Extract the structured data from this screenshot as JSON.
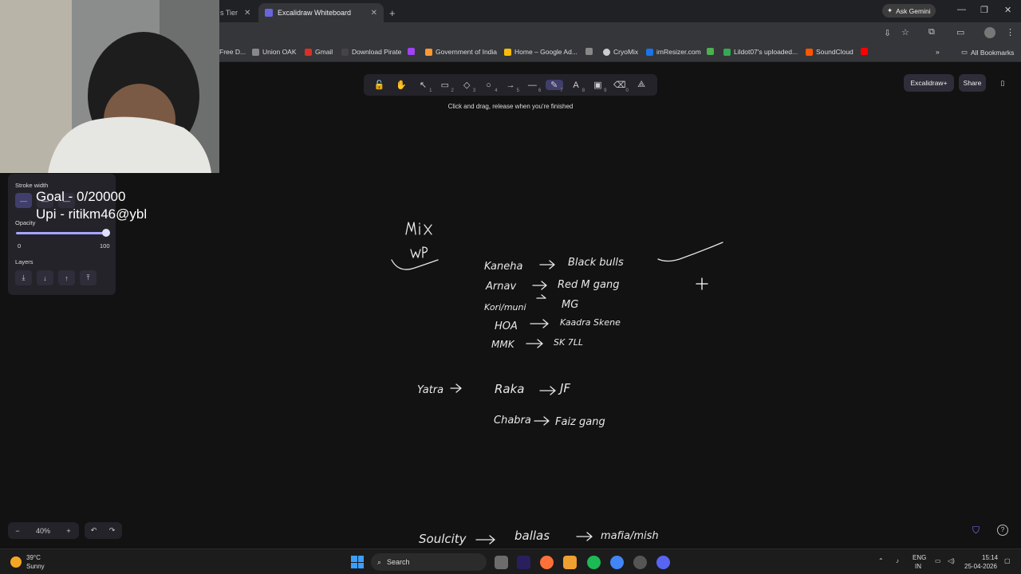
{
  "browser": {
    "tabs": [
      {
        "label": "s Tier",
        "active": false
      },
      {
        "label": "Excalidraw Whiteboard",
        "active": true
      }
    ],
    "new_tab": "+",
    "ask_gemini": "Ask Gemini",
    "bookmarks": [
      {
        "label": "Free D...",
        "color": "#3c7a3c"
      },
      {
        "label": "Union OAK",
        "color": "#888888"
      },
      {
        "label": "Gmail",
        "color": "#d93025"
      },
      {
        "label": "Download Pirate",
        "color": "#444444"
      },
      {
        "label": "",
        "color": "#a142f4"
      },
      {
        "label": "Government of India",
        "color": "#ff9933"
      },
      {
        "label": "Home – Google Ad...",
        "color": "#fbbc04"
      },
      {
        "label": "",
        "color": "#888888"
      },
      {
        "label": "CryoMix",
        "color": "#cccccc"
      },
      {
        "label": "imResizer.com",
        "color": "#1a73e8"
      },
      {
        "label": "",
        "color": "#4caf50"
      },
      {
        "label": "Lildot07's uploaded...",
        "color": "#34a853"
      },
      {
        "label": "SoundCloud",
        "color": "#ff5500"
      },
      {
        "label": "",
        "color": "#ff0000"
      }
    ],
    "all_bookmarks": "All Bookmarks"
  },
  "excalidraw": {
    "tools": [
      {
        "icon": "lock-icon",
        "glyph": "🔓",
        "key": ""
      },
      {
        "icon": "hand-icon",
        "glyph": "✋",
        "key": ""
      },
      {
        "icon": "pointer-icon",
        "glyph": "↖",
        "key": "1"
      },
      {
        "icon": "rectangle-icon",
        "glyph": "▭",
        "key": "2"
      },
      {
        "icon": "diamond-icon",
        "glyph": "◇",
        "key": "3"
      },
      {
        "icon": "ellipse-icon",
        "glyph": "○",
        "key": "4"
      },
      {
        "icon": "arrow-icon",
        "glyph": "→",
        "key": "5"
      },
      {
        "icon": "line-icon",
        "glyph": "—",
        "key": "6"
      },
      {
        "icon": "pencil-icon",
        "glyph": "✎",
        "key": "7"
      },
      {
        "icon": "text-icon",
        "glyph": "A",
        "key": "8"
      },
      {
        "icon": "image-icon",
        "glyph": "▣",
        "key": "9"
      },
      {
        "icon": "eraser-icon",
        "glyph": "⌫",
        "key": "0"
      },
      {
        "icon": "shapes-icon",
        "glyph": "⟁",
        "key": ""
      }
    ],
    "hint": "Click and drag, release when you're finished",
    "excalidraw_plus": "Excalidraw+",
    "share": "Share",
    "props": {
      "stroke_width": "Stroke width",
      "opacity": "Opacity",
      "opacity_min": "0",
      "opacity_max": "100",
      "opacity_value": 100,
      "layers": "Layers"
    },
    "zoom": "40%",
    "zoom_minus": "−",
    "zoom_plus": "+"
  },
  "overlay": {
    "goal": "Goal - 0/20000",
    "upi": "Upi - ritikm46@ybl"
  },
  "taskbar": {
    "weather_temp": "39°C",
    "weather_desc": "Sunny",
    "search": "Search",
    "lang1": "ENG",
    "lang2": "IN",
    "time": "15:14",
    "date": "25-04-2026"
  }
}
